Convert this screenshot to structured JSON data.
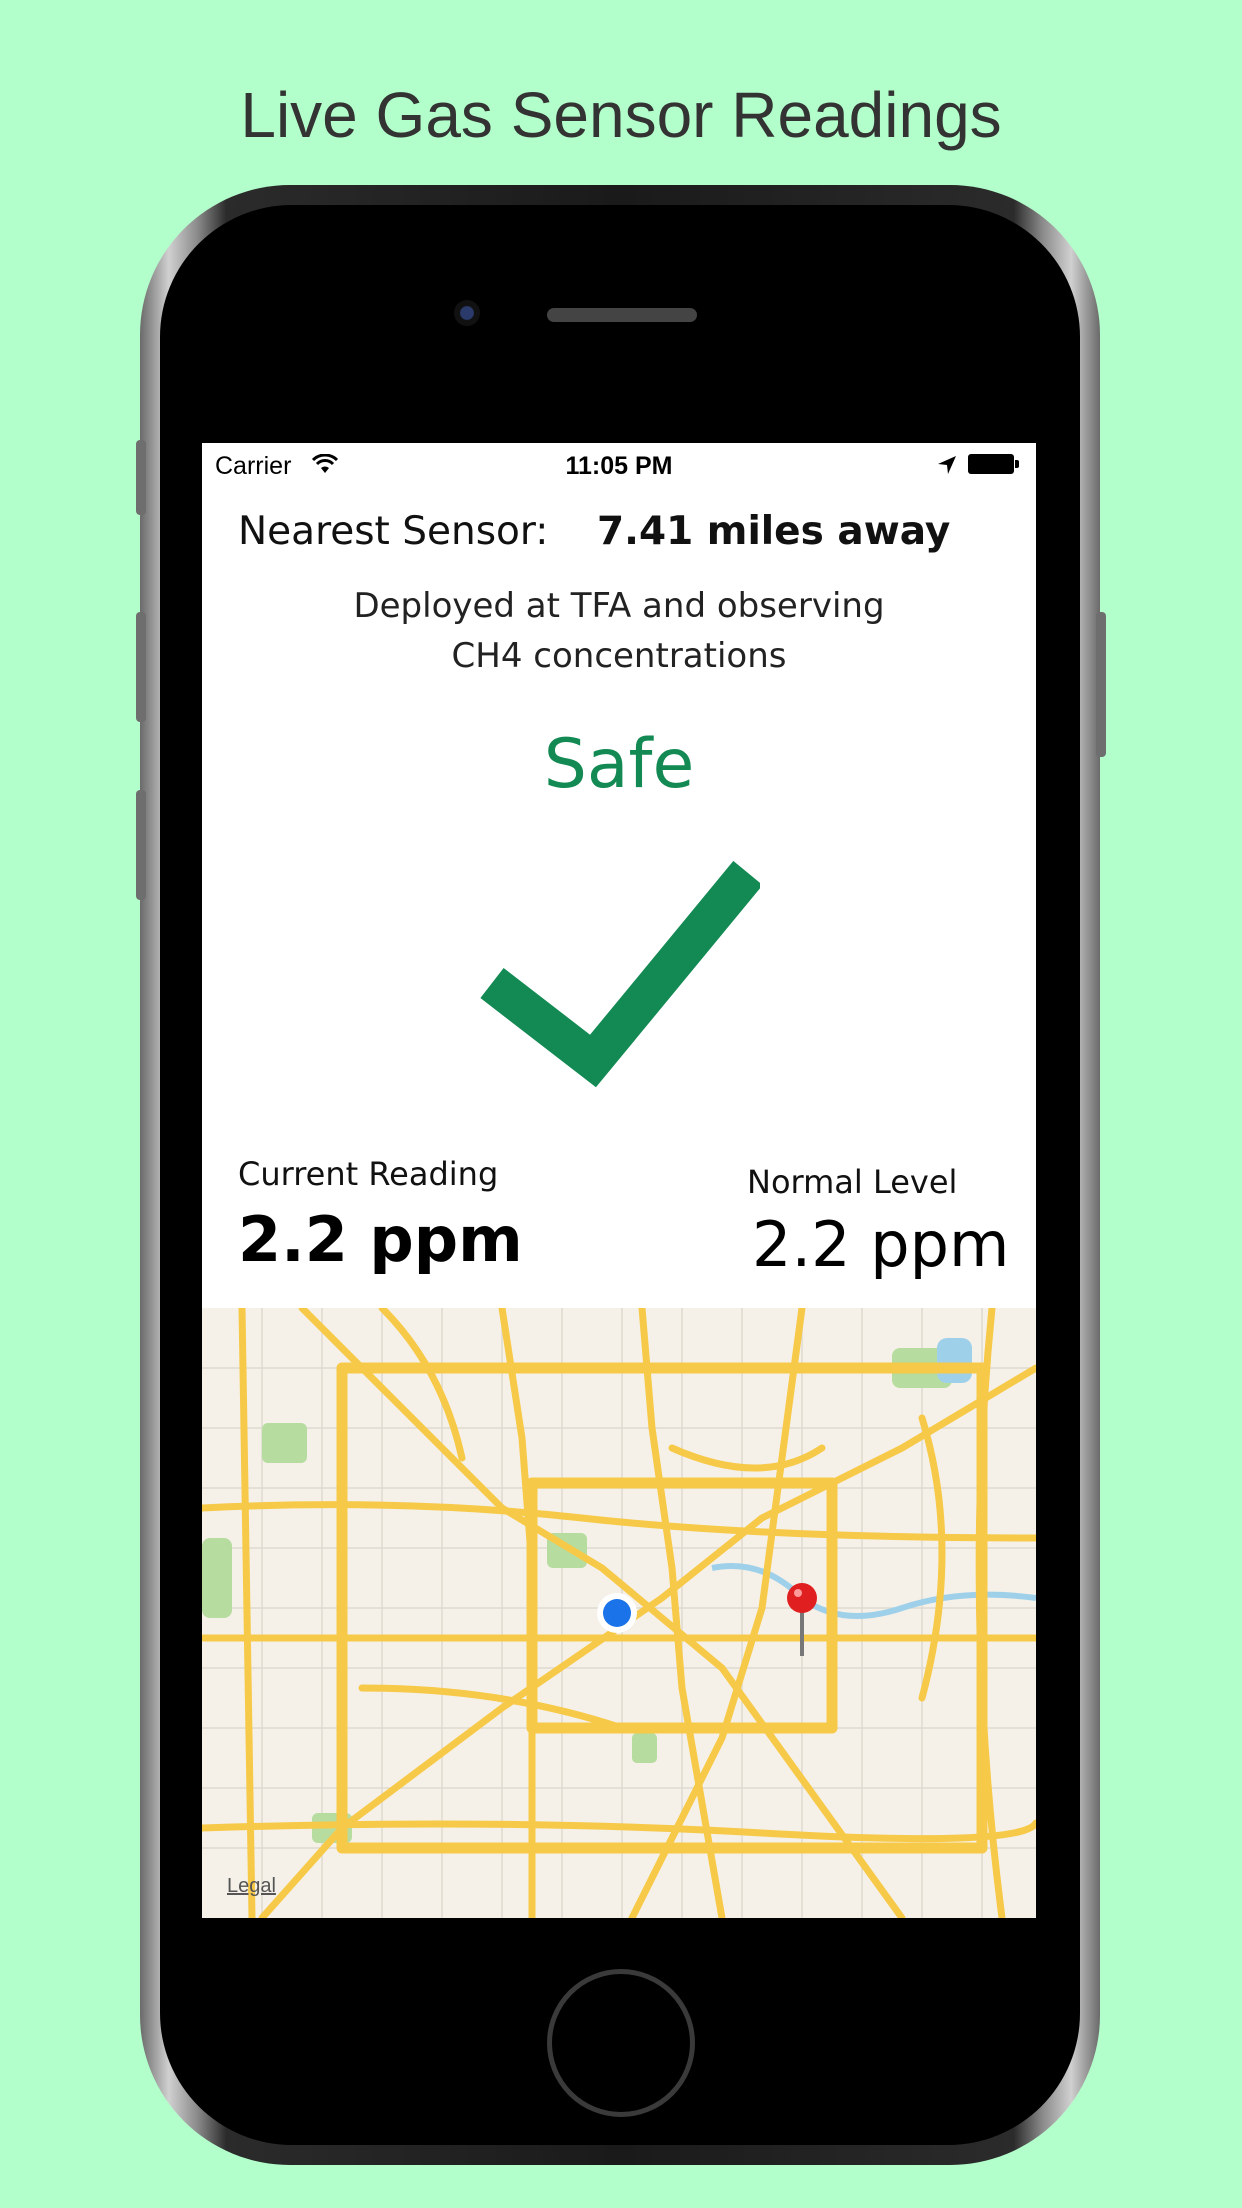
{
  "promo": {
    "title": "Live Gas Sensor Readings"
  },
  "status_bar": {
    "carrier": "Carrier",
    "time": "11:05 PM"
  },
  "sensor": {
    "nearest_label": "Nearest Sensor:",
    "distance": "7.41 miles away",
    "deployed_line1": "Deployed at TFA and observing",
    "deployed_line2": "CH4 concentrations",
    "status": "Safe"
  },
  "readings": {
    "current_label": "Current Reading",
    "current_value": "2.2 ppm",
    "normal_label": "Normal Level",
    "normal_value": "2.2 ppm"
  },
  "map": {
    "legal_link": "Legal"
  },
  "colors": {
    "background": "#b3ffcb",
    "safe_green": "#138a53",
    "road_yellow": "#f7c948",
    "user_location_blue": "#1a73e8",
    "pin_red": "#e02020"
  }
}
